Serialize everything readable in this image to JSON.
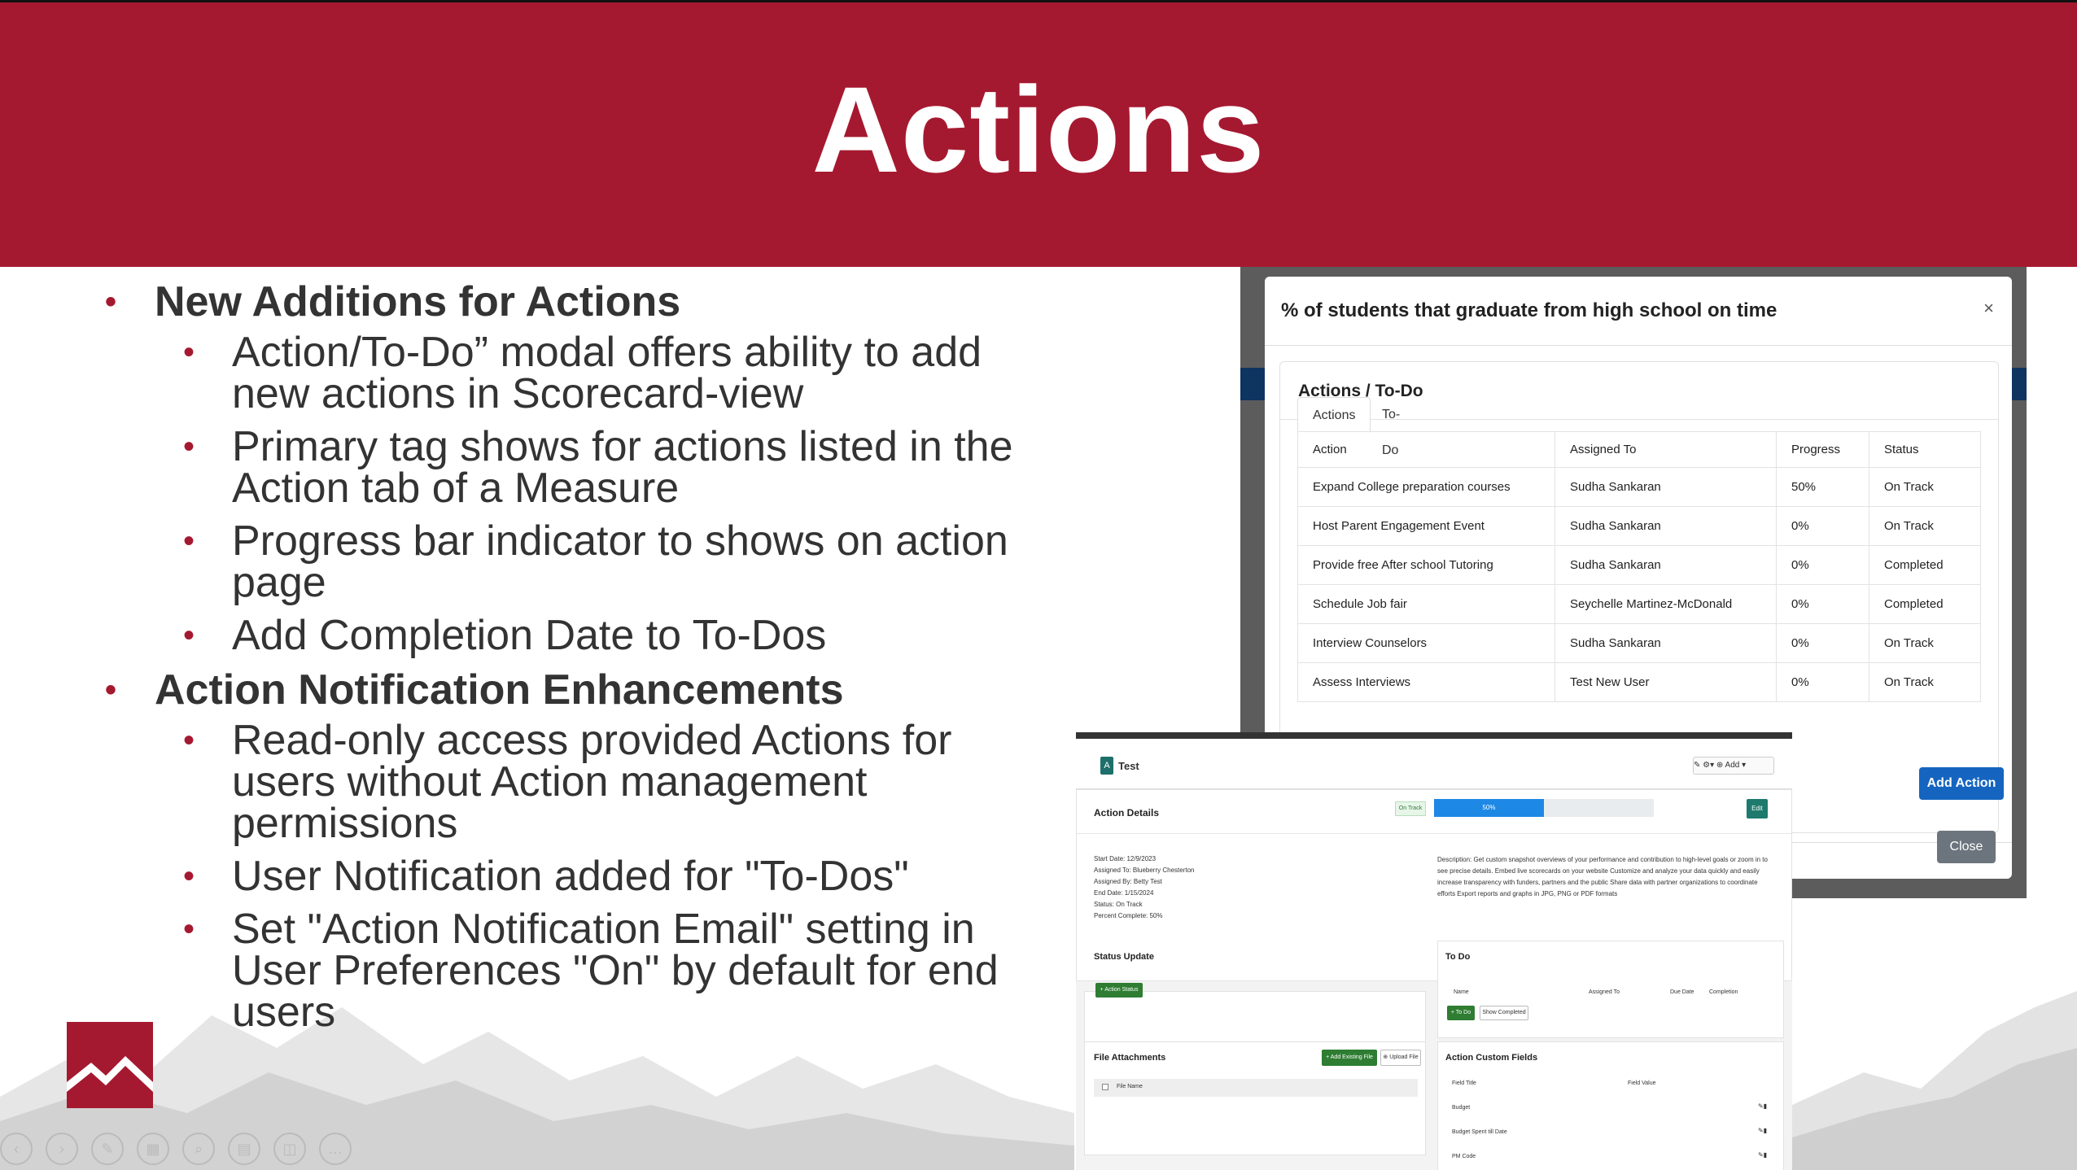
{
  "slide": {
    "title": "Actions",
    "brand_color": "#a51930"
  },
  "bullets": [
    {
      "text": "New Additions for Actions",
      "children": [
        "Action/To-Do” modal offers ability to add new actions in Scorecard-view",
        "Primary tag shows for actions listed in the Action tab of a Measure",
        "Progress bar indicator to shows on action page",
        "Add Completion Date to To-Dos"
      ]
    },
    {
      "text": "Action Notification Enhancements",
      "children": [
        "Read-only access provided Actions for users without Action management permissions",
        "User Notification added for \"To-Dos\"",
        "Set \"Action Notification Email\" setting in User Preferences \"On\" by default for end users"
      ]
    }
  ],
  "modal": {
    "title": "% of students that graduate from high school on time",
    "close_icon": "×",
    "card_title": "Actions / To-Do",
    "tabs": [
      "Actions",
      "To-Do"
    ],
    "columns": [
      "Action",
      "Assigned To",
      "Progress",
      "Status"
    ],
    "rows": [
      [
        "Expand College preparation courses",
        "Sudha Sankaran",
        "50%",
        "On Track"
      ],
      [
        "Host Parent Engagement Event",
        "Sudha Sankaran",
        "0%",
        "On Track"
      ],
      [
        "Provide free After school Tutoring",
        "Sudha Sankaran",
        "0%",
        "Completed"
      ],
      [
        "Schedule Job fair",
        "Seychelle Martinez-McDonald",
        "0%",
        "Completed"
      ],
      [
        "Interview Counselors",
        "Sudha Sankaran",
        "0%",
        "On Track"
      ],
      [
        "Assess Interviews",
        "Test New User",
        "0%",
        "On Track"
      ]
    ],
    "add_button": "Add Action",
    "close_button": "Close"
  },
  "action_page": {
    "name": "Test",
    "badge": "A",
    "tools": "✎  ⚙▾  ⊕ Add ▾",
    "details_title": "Action Details",
    "status_pill": "On Track",
    "progress_label": "50%",
    "progress": 0.5,
    "edit_button": "Edit",
    "fields": [
      "Start Date:  12/9/2023",
      "Assigned To:  Blueberry Chesterton",
      "Assigned By:  Betty Test",
      "End Date:  1/15/2024",
      "Status:  On Track",
      "Percent Complete:  50%"
    ],
    "description": "Description:  Get custom snapshot overviews of your performance and contribution to high-level goals or zoom in to see precise details. Embed live scorecards on your website Customize and analyze your data quickly and easily increase transparency with funders, partners and the public Share data with partner organizations to coordinate efforts Export reports and graphs in JPG, PNG or PDF formats",
    "status_update_title": "Status Update",
    "action_status_button": "+ Action Status",
    "todo_title": "To Do",
    "todo_columns": [
      "Name",
      "Assigned To",
      "Due Date",
      "Completion"
    ],
    "todo_add_button": "+ To Do",
    "show_completed_button": "Show Completed",
    "attachments_title": "File Attachments",
    "add_existing_button": "+ Add Existing File",
    "upload_button": "⊕ Upload File",
    "file_name_col": "File Name",
    "custom_fields_title": "Action Custom Fields",
    "custom_columns": [
      "Field Title",
      "Field Value"
    ],
    "custom_rows": [
      "Budget",
      "Budget Spent till Date",
      "PM Code"
    ]
  }
}
